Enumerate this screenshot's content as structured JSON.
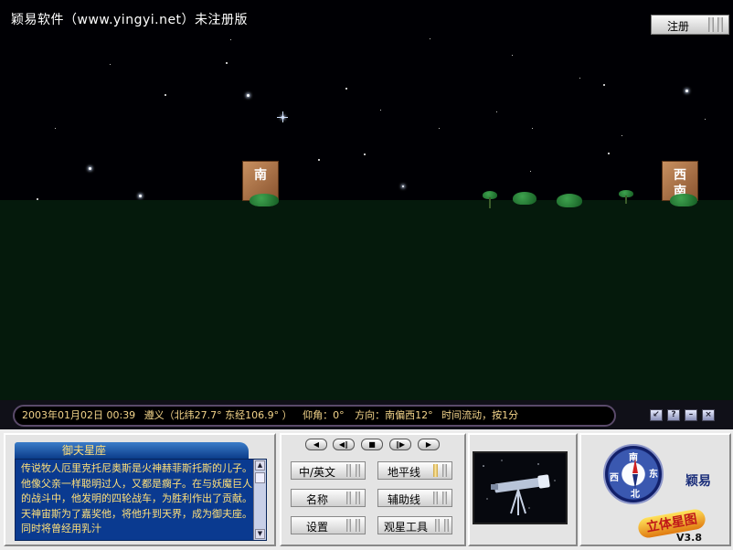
{
  "window": {
    "watermark": "颖易软件（www.yingyi.net）未注册版",
    "register_label": "注册"
  },
  "scene": {
    "signs": [
      {
        "text": "南"
      },
      {
        "text": "西南"
      }
    ]
  },
  "status": {
    "datetime": "2003年01月02日 00:39",
    "location": "遵义（北纬27.7° 东经106.9° ）",
    "elevation": "仰角：0°",
    "direction": "方向：南偏西12°",
    "time_flow": "时间流动，按1分"
  },
  "window_controls": [
    {
      "icon": "restore-icon",
      "glyph": "↙"
    },
    {
      "icon": "help-icon",
      "glyph": "?"
    },
    {
      "icon": "minimize-icon",
      "glyph": "–"
    },
    {
      "icon": "close-icon",
      "glyph": "×"
    }
  ],
  "info": {
    "title": "御夫星座",
    "text": "传说牧人厄里克托尼奥斯是火神赫菲斯托斯的儿子。他像父亲一样聪明过人，又都是瘸子。在与妖魔巨人的战斗中，他发明的四轮战车，为胜利作出了贡献。天神宙斯为了嘉奖他，将他升到天界，成为御夫座。同时将曾经用乳汁"
  },
  "playback": [
    {
      "name": "rewind-button",
      "glyph": "◀"
    },
    {
      "name": "step-back-button",
      "glyph": "◀‖"
    },
    {
      "name": "stop-button",
      "glyph": "■"
    },
    {
      "name": "step-forward-button",
      "glyph": "‖▶"
    },
    {
      "name": "play-button",
      "glyph": "▶"
    }
  ],
  "controls": {
    "language": "中/英文",
    "names": "名称",
    "settings": "设置",
    "horizon": "地平线",
    "guides": "辅助线",
    "tools": "观星工具"
  },
  "brand": {
    "compass_labels": [
      "南",
      "东",
      "北",
      "西"
    ],
    "company": "颖易",
    "product": "立体星图",
    "version": "V3.8"
  },
  "colors": {
    "sky": "#000004",
    "ground": "#051a0c",
    "status_text": "#f3d48a",
    "info_bg": "#0a3a90"
  }
}
